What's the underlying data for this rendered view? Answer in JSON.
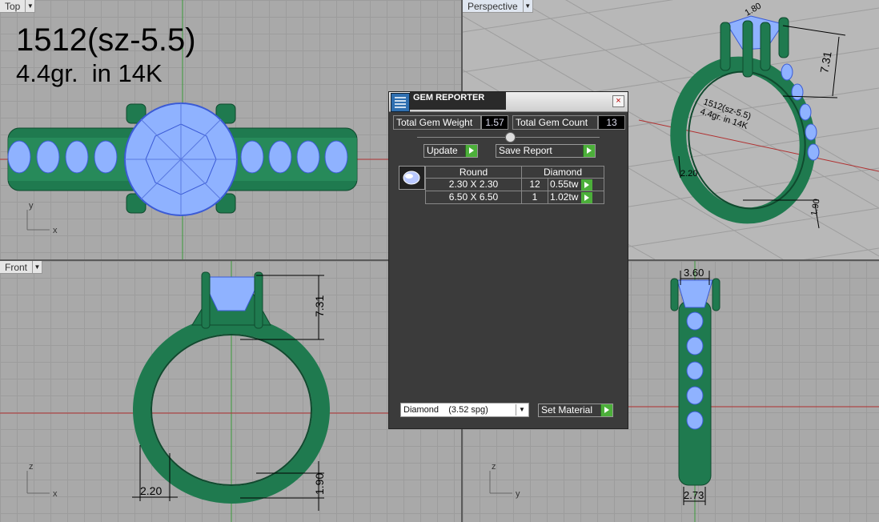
{
  "viewports": {
    "top": {
      "label": "Top",
      "axis_h": "x",
      "axis_v": "y"
    },
    "perspective": {
      "label": "Perspective"
    },
    "front": {
      "label": "Front",
      "axis_h": "x",
      "axis_v": "z"
    },
    "right": {
      "axis_h": "y",
      "axis_v": "z"
    }
  },
  "annotation": {
    "line1": "1512(sz-5.5)",
    "line2": "4.4gr.  in 14K"
  },
  "perspective_engraving": {
    "line1": "1512(sz-5.5)",
    "line2": "4.4gr. in 14K"
  },
  "dimensions": {
    "front_height": "7.31",
    "front_width": "2.20",
    "front_bottom": "1.90",
    "right_top": "3.60",
    "right_bottom": "2.73",
    "persp_top": "1.80",
    "persp_height": "7.31",
    "persp_side": "2.20",
    "persp_bottom": "1.90"
  },
  "gem_reporter": {
    "title": "GEM REPORTER",
    "close": "×",
    "total_weight_label": "Total Gem Weight",
    "total_weight": "1.57",
    "total_count_label": "Total Gem Count",
    "total_count": "13",
    "update_label": "Update",
    "save_label": "Save Report",
    "table_header": {
      "shape": "Round",
      "material": "Diamond"
    },
    "rows": [
      {
        "size": "2.30 X 2.30",
        "count": "12",
        "weight": "0.55tw"
      },
      {
        "size": "6.50 X 6.50",
        "count": "1",
        "weight": "1.02tw"
      }
    ],
    "material_select": "Diamond    (3.52 spg)",
    "set_material_label": "Set Material"
  },
  "colors": {
    "metal": "#1f7a4f",
    "gem": "#8fb2ff",
    "grid": "#a9a9a9"
  }
}
